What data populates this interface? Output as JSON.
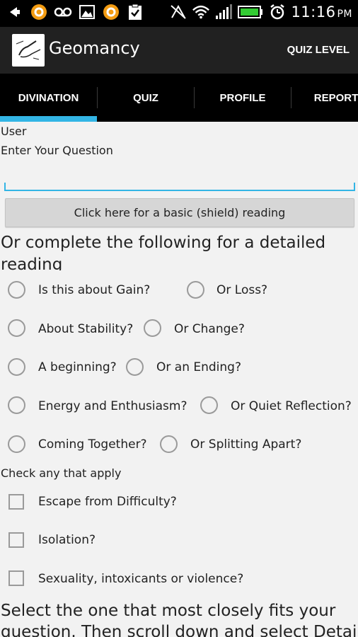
{
  "status_bar": {
    "icons_left": [
      "back-icon",
      "orange-app-icon",
      "voicemail-icon",
      "gallery-icon",
      "orange-app-icon",
      "clipboard-check-icon"
    ],
    "icons_right": [
      "nfc-off-icon",
      "wifi-icon",
      "signal-icon",
      "battery-icon",
      "alarm-icon"
    ],
    "time": "11:16",
    "ampm": "PM"
  },
  "action_bar": {
    "title": "Geomancy",
    "action_label": "QUIZ LEVEL"
  },
  "tabs": [
    {
      "label": "DIVINATION",
      "selected": true
    },
    {
      "label": "QUIZ",
      "selected": false
    },
    {
      "label": "PROFILE",
      "selected": false
    },
    {
      "label": "REPORTS",
      "selected": false
    }
  ],
  "colors": {
    "accent": "#33b5e5",
    "action_bar": "#212121",
    "background": "#f2f2f2"
  },
  "form": {
    "user_label": "User",
    "question_label": "Enter Your Question",
    "question_value": "",
    "shield_button_label": "Click here for a basic (shield) reading",
    "detailed_heading_line1": "Or complete the following for a detailed",
    "detailed_heading_line2": "reading",
    "radio_pairs": [
      {
        "left": "Is this about Gain?",
        "right": "Or Loss?"
      },
      {
        "left": "About Stability?",
        "right": "Or Change?"
      },
      {
        "left": "A beginning?",
        "right": "Or an Ending?"
      },
      {
        "left": "Energy and Enthusiasm?",
        "right": "Or Quiet Reflection?"
      },
      {
        "left": "Coming Together?",
        "right": "Or Splitting Apart?"
      }
    ],
    "check_heading": "Check any that apply",
    "checkboxes": [
      {
        "label": "Escape from Difficulty?",
        "checked": false
      },
      {
        "label": "Isolation?",
        "checked": false
      },
      {
        "label": "Sexuality, intoxicants or violence?",
        "checked": false
      }
    ],
    "select_line1": "Select the one that most closely fits your",
    "select_line2": "question. Then scroll down and select Detail"
  }
}
